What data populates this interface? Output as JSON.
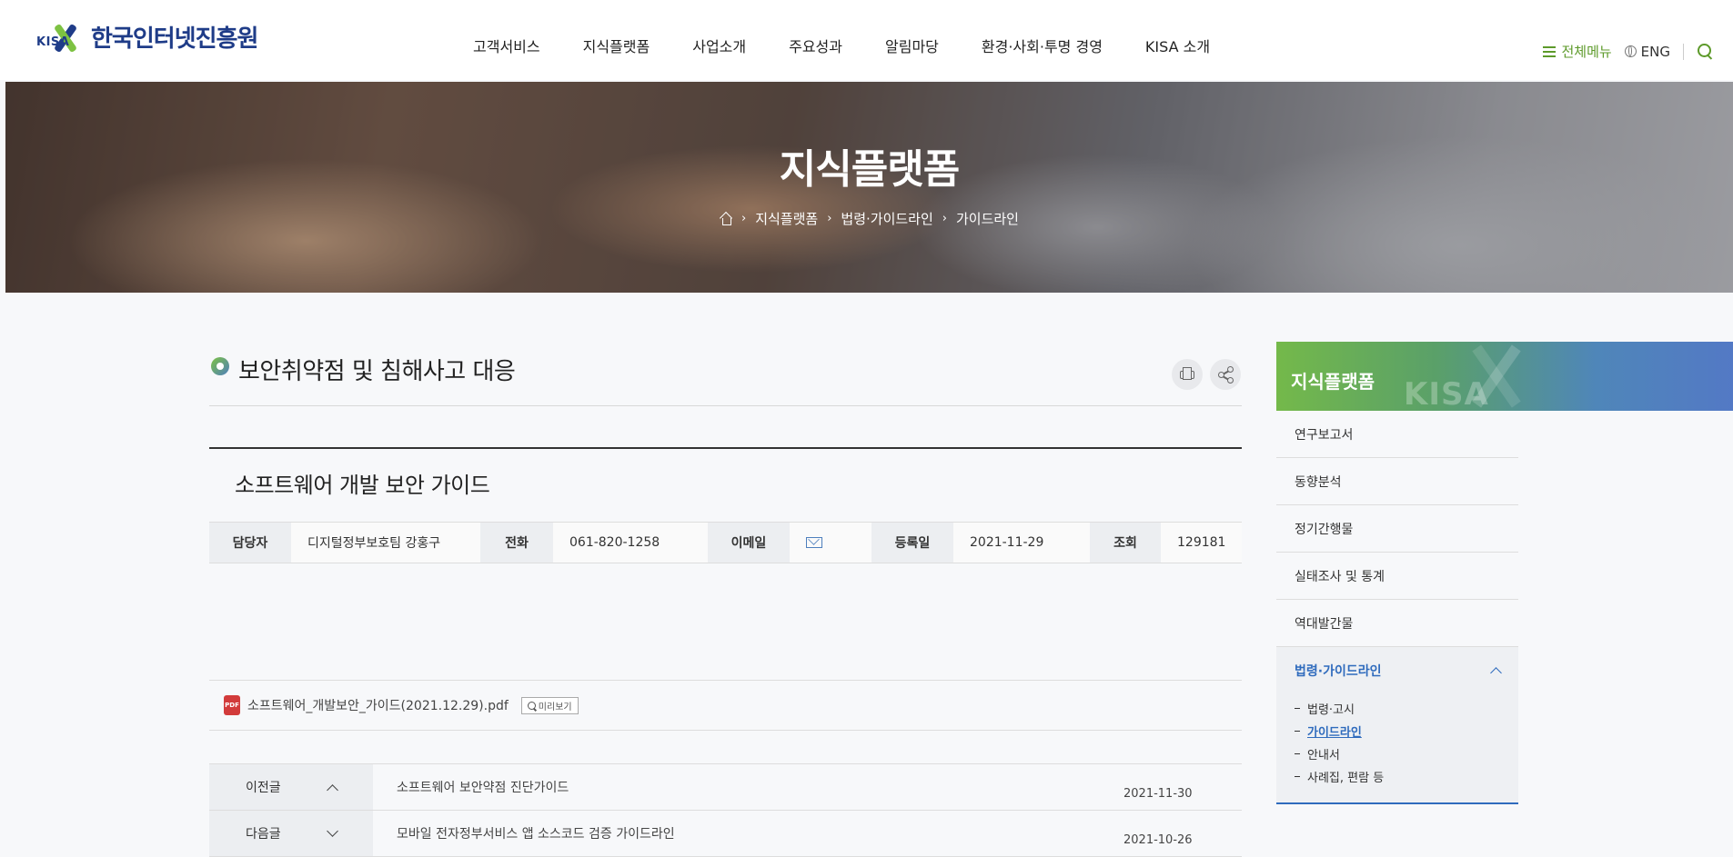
{
  "header": {
    "logo_mark": "KISA",
    "logo_text": "한국인터넷진흥원",
    "nav": [
      "고객서비스",
      "지식플랫폼",
      "사업소개",
      "주요성과",
      "알림마당",
      "환경·사회·투명 경영",
      "KISA 소개"
    ],
    "all_menu_label": "전체메뉴",
    "eng_label": "ENG"
  },
  "hero": {
    "title": "지식플랫폼",
    "breadcrumb": [
      "지식플랫폼",
      "법령·가이드라인",
      "가이드라인"
    ]
  },
  "page": {
    "title": "보안취약점 및 침해사고 대응"
  },
  "post": {
    "title": "소프트웨어 개발 보안 가이드",
    "meta": {
      "manager_label": "담당자",
      "manager_value": "디지털정부보호팀 강홍구",
      "phone_label": "전화",
      "phone_value": "061-820-1258",
      "email_label": "이메일",
      "date_label": "등록일",
      "date_value": "2021-11-29",
      "views_label": "조회",
      "views_value": "129181"
    },
    "attachment": {
      "icon_text": "PDF",
      "filename": "소프트웨어_개발보안_가이드(2021.12.29).pdf",
      "preview_label": "미리보기"
    },
    "prev": {
      "label": "이전글",
      "subject": "소프트웨어 보안약점 진단가이드",
      "date": "2021-11-30"
    },
    "next": {
      "label": "다음글",
      "subject": "모바일 전자정부서비스 앱 소스코드 검증 가이드라인",
      "date": "2021-10-26"
    }
  },
  "side": {
    "title": "지식플랫폼",
    "watermark": "KISA",
    "items": [
      "연구보고서",
      "동향분석",
      "정기간행물",
      "실태조사 및 통계",
      "역대발간물"
    ],
    "active_parent": "법령·가이드라인",
    "sub_items": [
      "법령·고시",
      "가이드라인",
      "안내서",
      "사례집, 편람 등"
    ],
    "current_sub": "가이드라인"
  }
}
